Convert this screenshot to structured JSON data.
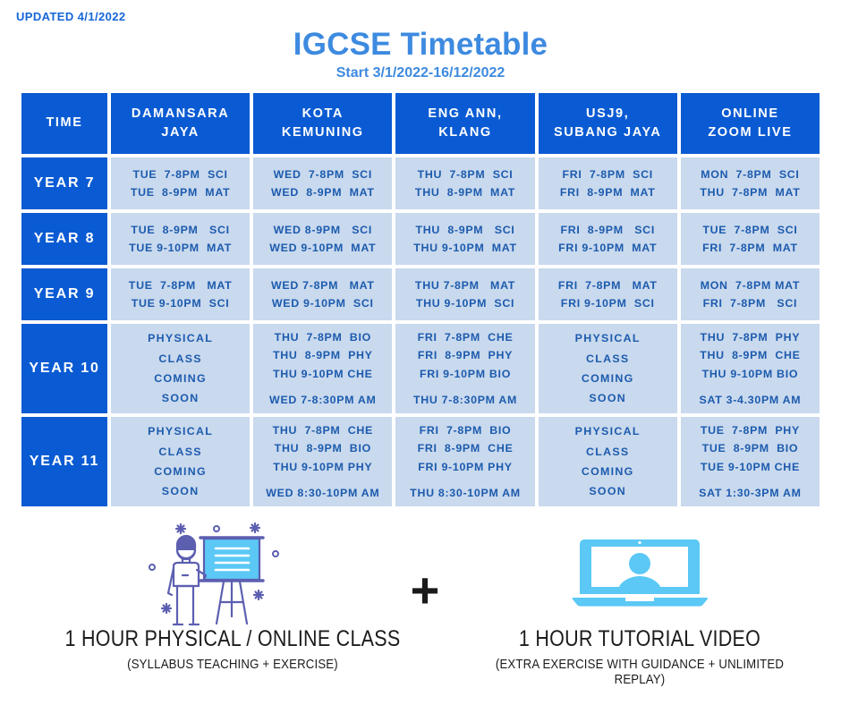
{
  "updated_label": "UPDATED 4/1/2022",
  "title": {
    "main": "IGCSE Timetable",
    "sub": "Start 3/1/2022-16/12/2022"
  },
  "colors": {
    "header_blue": "#0a5bd3",
    "title_blue": "#3d8ae0",
    "cell_bg": "#c9d9ee",
    "cell_text": "#1c5bad",
    "art_light_blue": "#5bc8f5",
    "art_purple": "#5c5fb0"
  },
  "table": {
    "headers": [
      {
        "line1": "TIME",
        "line2": ""
      },
      {
        "line1": "DAMANSARA",
        "line2": "JAYA"
      },
      {
        "line1": "KOTA",
        "line2": "KEMUNING"
      },
      {
        "line1": "ENG ANN,",
        "line2": "KLANG"
      },
      {
        "line1": "USJ9,",
        "line2": "SUBANG JAYA"
      },
      {
        "line1": "ONLINE",
        "line2": "ZOOM LIVE"
      }
    ],
    "rows": [
      {
        "year": "YEAR 7",
        "cells": [
          {
            "placeholder": false,
            "lines": [
              "TUE  7-8PM  SCI",
              "TUE  8-9PM  MAT"
            ]
          },
          {
            "placeholder": false,
            "lines": [
              "WED  7-8PM  SCI",
              "WED  8-9PM  MAT"
            ]
          },
          {
            "placeholder": false,
            "lines": [
              "THU  7-8PM  SCI",
              "THU  8-9PM  MAT"
            ]
          },
          {
            "placeholder": false,
            "lines": [
              "FRI  7-8PM  SCI",
              "FRI  8-9PM  MAT"
            ]
          },
          {
            "placeholder": false,
            "lines": [
              "MON  7-8PM  SCI",
              "THU  7-8PM  MAT"
            ]
          }
        ]
      },
      {
        "year": "YEAR 8",
        "cells": [
          {
            "placeholder": false,
            "lines": [
              "TUE  8-9PM   SCI",
              "TUE 9-10PM  MAT"
            ]
          },
          {
            "placeholder": false,
            "lines": [
              "WED 8-9PM   SCI",
              "WED 9-10PM  MAT"
            ]
          },
          {
            "placeholder": false,
            "lines": [
              "THU  8-9PM   SCI",
              "THU 9-10PM  MAT"
            ]
          },
          {
            "placeholder": false,
            "lines": [
              "FRI  8-9PM   SCI",
              "FRI 9-10PM  MAT"
            ]
          },
          {
            "placeholder": false,
            "lines": [
              "TUE  7-8PM  SCI",
              "FRI  7-8PM  MAT"
            ]
          }
        ]
      },
      {
        "year": "YEAR 9",
        "cells": [
          {
            "placeholder": false,
            "lines": [
              "TUE  7-8PM   MAT",
              "TUE 9-10PM  SCI"
            ]
          },
          {
            "placeholder": false,
            "lines": [
              "WED 7-8PM   MAT",
              "WED 9-10PM  SCI"
            ]
          },
          {
            "placeholder": false,
            "lines": [
              "THU 7-8PM   MAT",
              "THU 9-10PM  SCI"
            ]
          },
          {
            "placeholder": false,
            "lines": [
              "FRI  7-8PM   MAT",
              "FRI 9-10PM  SCI"
            ]
          },
          {
            "placeholder": false,
            "lines": [
              "MON  7-8PM MAT",
              "FRI  7-8PM   SCI"
            ]
          }
        ]
      },
      {
        "year": "YEAR 10",
        "cells": [
          {
            "placeholder": true,
            "lines": [
              "PHYSICAL",
              "CLASS",
              "COMING",
              "SOON"
            ]
          },
          {
            "placeholder": false,
            "lines": [
              "THU  7-8PM  BIO",
              "THU  8-9PM  PHY",
              "THU 9-10PM CHE",
              "WED 7-8:30PM AM"
            ]
          },
          {
            "placeholder": false,
            "lines": [
              "FRI  7-8PM  CHE",
              "FRI  8-9PM  PHY",
              "FRI 9-10PM BIO",
              "THU 7-8:30PM AM"
            ]
          },
          {
            "placeholder": true,
            "lines": [
              "PHYSICAL",
              "CLASS",
              "COMING",
              "SOON"
            ]
          },
          {
            "placeholder": false,
            "lines": [
              "THU  7-8PM  PHY",
              "THU  8-9PM  CHE",
              "THU 9-10PM BIO",
              "SAT 3-4.30PM AM"
            ]
          }
        ]
      },
      {
        "year": "YEAR 11",
        "cells": [
          {
            "placeholder": true,
            "lines": [
              "PHYSICAL",
              "CLASS",
              "COMING",
              "SOON"
            ]
          },
          {
            "placeholder": false,
            "lines": [
              "THU  7-8PM  CHE",
              "THU  8-9PM  BIO",
              "THU 9-10PM PHY",
              "WED 8:30-10PM AM"
            ]
          },
          {
            "placeholder": false,
            "lines": [
              "FRI  7-8PM  BIO",
              "FRI  8-9PM  CHE",
              "FRI 9-10PM PHY",
              "THU 8:30-10PM AM"
            ]
          },
          {
            "placeholder": true,
            "lines": [
              "PHYSICAL",
              "CLASS",
              "COMING",
              "SOON"
            ]
          },
          {
            "placeholder": false,
            "lines": [
              "TUE  7-8PM  PHY",
              "TUE  8-9PM  BIO",
              "TUE 9-10PM CHE",
              "SAT 1:30-3PM AM"
            ]
          }
        ]
      }
    ]
  },
  "footer": {
    "plus": "+",
    "left": {
      "icon": "presentation-teacher-icon",
      "main": "1 HOUR PHYSICAL / ONLINE CLASS",
      "sub": "(SYLLABUS TEACHING + EXERCISE)"
    },
    "right": {
      "icon": "laptop-video-icon",
      "main": "1 HOUR TUTORIAL VIDEO",
      "sub": "(EXTRA EXERCISE WITH GUIDANCE + UNLIMITED REPLAY)"
    }
  }
}
